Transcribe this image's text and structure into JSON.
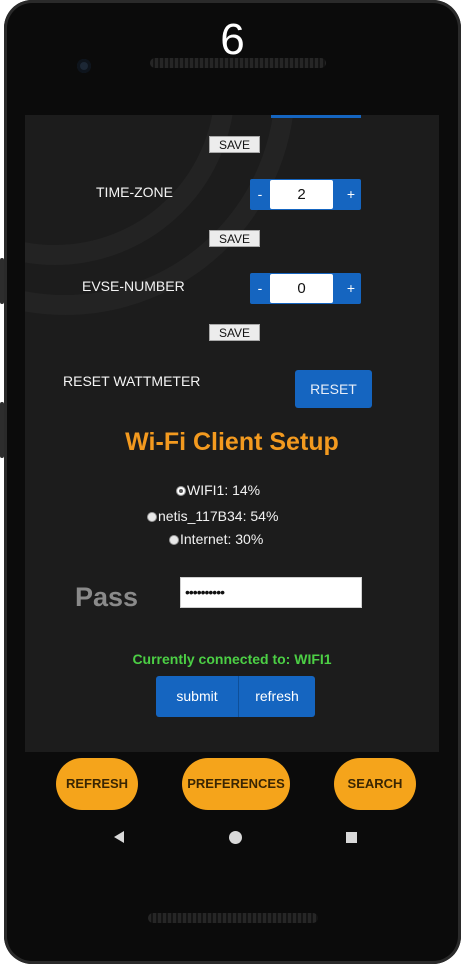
{
  "device": {
    "top_number": "6"
  },
  "settings": {
    "save_label": "SAVE",
    "time_zone": {
      "label": "TIME-ZONE",
      "value": "2"
    },
    "evse_number": {
      "label": "EVSE-NUMBER",
      "value": "0"
    },
    "stepper": {
      "minus": "-",
      "plus": "+"
    },
    "reset_wattmeter": {
      "label": "RESET WATTMETER",
      "button": "RESET"
    }
  },
  "wifi": {
    "title": "Wi-Fi Client Setup",
    "networks": [
      {
        "label": "WIFI1: 14%",
        "selected": true
      },
      {
        "label": "netis_117B34: 54%",
        "selected": false
      },
      {
        "label": "Internet: 30%",
        "selected": false
      }
    ],
    "pass_label": "Pass",
    "pass_value": "••••••••••",
    "connected_text": "Currently connected to: WIFI1",
    "submit_label": "submit",
    "refresh_label": "refresh"
  },
  "bottom_bar": {
    "refresh": "REFRESH",
    "preferences": "PREFERENCES",
    "search": "SEARCH"
  },
  "colors": {
    "accent_orange": "#f5a41b",
    "primary_blue": "#1565c0",
    "connected_green": "#4ccf45",
    "title_orange": "#f39a1f"
  }
}
